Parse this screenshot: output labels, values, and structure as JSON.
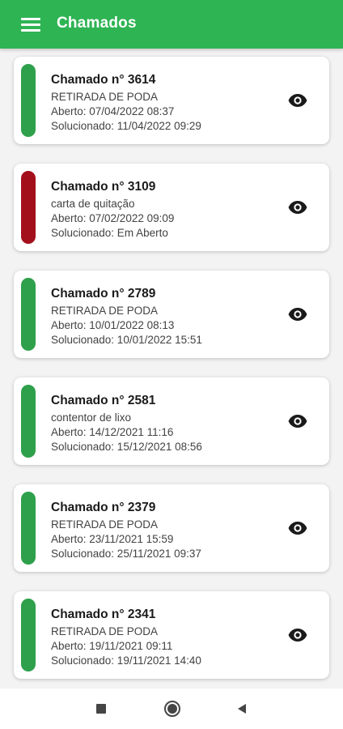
{
  "app_bar": {
    "title": "Chamados",
    "menu_icon": "menu-icon",
    "background": "#2fb454"
  },
  "tickets": [
    {
      "title": "Chamado n° 3614",
      "description": "RETIRADA DE PODA",
      "opened": "Aberto: 07/04/2022 08:37",
      "solved": "Solucionado: 11/04/2022 09:29",
      "status_color": "#2ea04b",
      "action_icon": "eye-icon"
    },
    {
      "title": "Chamado n° 3109",
      "description": "carta de quitação",
      "opened": "Aberto: 07/02/2022 09:09",
      "solved": "Solucionado: Em Aberto",
      "status_color": "#a3101c",
      "action_icon": "eye-icon"
    },
    {
      "title": "Chamado n° 2789",
      "description": "RETIRADA DE PODA",
      "opened": "Aberto: 10/01/2022 08:13",
      "solved": "Solucionado: 10/01/2022 15:51",
      "status_color": "#2ea04b",
      "action_icon": "eye-icon"
    },
    {
      "title": "Chamado n° 2581",
      "description": "contentor de lixo",
      "opened": "Aberto: 14/12/2021 11:16",
      "solved": "Solucionado: 15/12/2021 08:56",
      "status_color": "#2ea04b",
      "action_icon": "eye-icon"
    },
    {
      "title": "Chamado n° 2379",
      "description": "RETIRADA DE PODA",
      "opened": "Aberto: 23/11/2021 15:59",
      "solved": "Solucionado: 25/11/2021 09:37",
      "status_color": "#2ea04b",
      "action_icon": "eye-icon"
    },
    {
      "title": "Chamado n° 2341",
      "description": "RETIRADA DE PODA",
      "opened": "Aberto: 19/11/2021 09:11",
      "solved": "Solucionado: 19/11/2021 14:40",
      "status_color": "#2ea04b",
      "action_icon": "eye-icon"
    }
  ],
  "nav_bar": {
    "recents_icon": "square-icon",
    "home_icon": "circle-home-icon",
    "back_icon": "triangle-back-icon"
  }
}
